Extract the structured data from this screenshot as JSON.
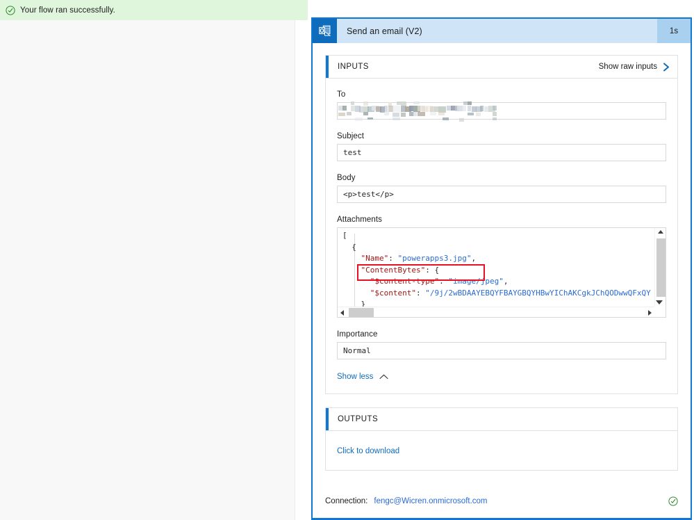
{
  "banner": {
    "icon": "success-check-circle-icon",
    "message": "Your flow ran successfully.",
    "background": "#dff6dd",
    "accent": "#107c10"
  },
  "card": {
    "app_icon": "outlook-icon",
    "title": "Send an email (V2)",
    "duration": "1s",
    "header_background": "#cfe4f7",
    "border_color": "#0f78d4"
  },
  "inputs_panel": {
    "title": "INPUTS",
    "action_label": "Show raw inputs",
    "action_icon": "chevron-right-icon",
    "fields": [
      {
        "label": "To",
        "value": "",
        "redacted": true
      },
      {
        "label": "Subject",
        "value": "test",
        "redacted": false
      },
      {
        "label": "Body",
        "value": "<p>test</p>",
        "redacted": false
      }
    ],
    "attachments": {
      "label": "Attachments",
      "lines": [
        {
          "indent": 0,
          "segments": [
            {
              "t": "[",
              "c": "p"
            }
          ]
        },
        {
          "indent": 1,
          "segments": [
            {
              "t": "{",
              "c": "p"
            }
          ]
        },
        {
          "indent": 2,
          "segments": [
            {
              "t": "\"Name\"",
              "c": "k"
            },
            {
              "t": ": ",
              "c": "p"
            },
            {
              "t": "\"powerapps3.jpg\"",
              "c": "s"
            },
            {
              "t": ",",
              "c": "p"
            }
          ]
        },
        {
          "indent": 2,
          "segments": [
            {
              "t": "\"ContentBytes\"",
              "c": "k"
            },
            {
              "t": ": {",
              "c": "p"
            }
          ]
        },
        {
          "indent": 3,
          "segments": [
            {
              "t": "\"$content-type\"",
              "c": "k"
            },
            {
              "t": ": ",
              "c": "p"
            },
            {
              "t": "\"image/jpeg\"",
              "c": "s"
            },
            {
              "t": ",",
              "c": "p"
            }
          ]
        },
        {
          "indent": 3,
          "segments": [
            {
              "t": "\"$content\"",
              "c": "k"
            },
            {
              "t": ": ",
              "c": "p"
            },
            {
              "t": "\"/9j/2wBDAAYEBQYFBAYGBQYHBwYIChAKCgkJChQODwwQFxQY",
              "c": "s"
            }
          ]
        },
        {
          "indent": 2,
          "segments": [
            {
              "t": "}",
              "c": "p"
            }
          ]
        },
        {
          "indent": 1,
          "segments": [
            {
              "t": "}",
              "c": "p"
            }
          ]
        }
      ],
      "highlight_color": "#e81123",
      "highlighted_line": "\"Name\": \"powerapps3.jpg\","
    },
    "importance": {
      "label": "Importance",
      "value": "Normal"
    },
    "show_less": {
      "label": "Show less",
      "icon": "chevron-up-icon"
    }
  },
  "outputs_panel": {
    "title": "OUTPUTS",
    "download_link": "Click to download"
  },
  "connection": {
    "label": "Connection:",
    "value": "fengc@Wicren.onmicrosoft.com",
    "status_icon": "check-circle-icon",
    "status_color": "#107c10"
  }
}
